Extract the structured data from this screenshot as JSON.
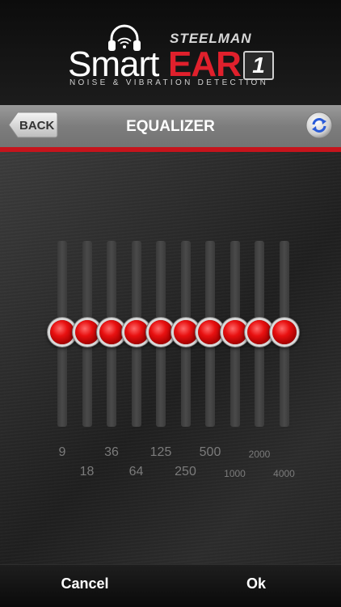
{
  "brand": {
    "steelman": "STEELMAN",
    "smart": "Smart",
    "ear": "EAR",
    "model": "1",
    "tagline": "NOISE & VIBRATION DETECTION"
  },
  "nav": {
    "back_label": "BACK",
    "title": "EQUALIZER"
  },
  "equalizer": {
    "bands": [
      {
        "freq": "9",
        "level": 0.5
      },
      {
        "freq": "18",
        "level": 0.5
      },
      {
        "freq": "36",
        "level": 0.5
      },
      {
        "freq": "64",
        "level": 0.5
      },
      {
        "freq": "125",
        "level": 0.5
      },
      {
        "freq": "250",
        "level": 0.5
      },
      {
        "freq": "500",
        "level": 0.5
      },
      {
        "freq": "1000",
        "level": 0.5
      },
      {
        "freq": "2000",
        "level": 0.5
      },
      {
        "freq": "4000",
        "level": 0.5
      }
    ]
  },
  "footer": {
    "cancel_label": "Cancel",
    "ok_label": "Ok"
  },
  "colors": {
    "accent_red": "#c6141c",
    "knob_red": "#e81010",
    "label_gray": "#7b7b7b"
  }
}
